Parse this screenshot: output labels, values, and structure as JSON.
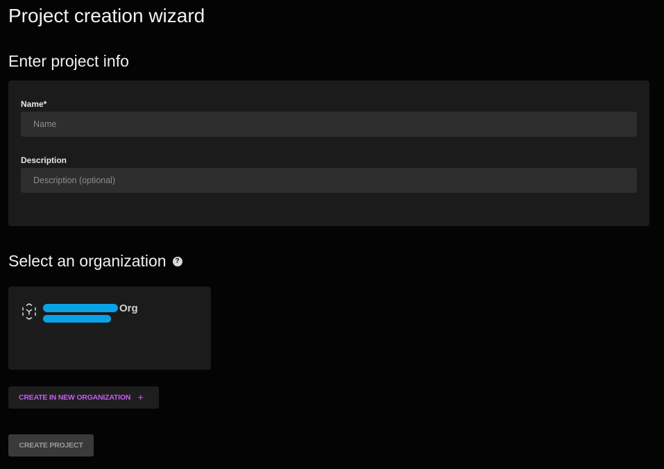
{
  "page": {
    "title": "Project creation wizard"
  },
  "project_info": {
    "section_title": "Enter project info",
    "name_label": "Name*",
    "name_placeholder": "Name",
    "name_value": "",
    "description_label": "Description",
    "description_placeholder": "Description (optional)",
    "description_value": ""
  },
  "organization": {
    "section_title": "Select an organization",
    "help_icon": "help-circle-icon",
    "card_icon": "dashed-cube-icon",
    "org_name_suffix": "Org",
    "org_name_redacted": true,
    "redaction_color": "#0aa2e6"
  },
  "actions": {
    "create_in_new_org_label": "CREATE IN NEW ORGANIZATION",
    "create_in_new_org_icon": "+",
    "create_project_label": "CREATE PROJECT",
    "create_project_disabled": true
  },
  "colors": {
    "background": "#040404",
    "card": "#1b1b1b",
    "input": "#2e2e2e",
    "accent": "#c55ef0"
  }
}
